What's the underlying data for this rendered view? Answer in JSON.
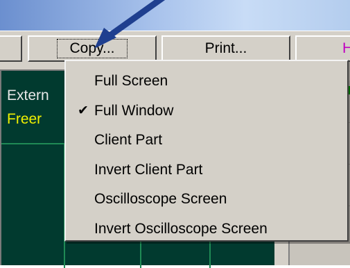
{
  "toolbar": {
    "copy_label": "Copy...",
    "print_label": "Print...",
    "right_stub_label": "H"
  },
  "scope": {
    "label_external": "Extern",
    "label_freerun": "Freer"
  },
  "menu": {
    "items": [
      {
        "label": "Full Screen",
        "checked": false
      },
      {
        "label": "Full Window",
        "checked": true
      },
      {
        "label": "Client Part",
        "checked": false
      },
      {
        "label": "Invert Client Part",
        "checked": false
      },
      {
        "label": "Oscilloscope Screen",
        "checked": false
      },
      {
        "label": "Invert Oscilloscope Screen",
        "checked": false
      }
    ],
    "check_glyph": "✔"
  },
  "colors": {
    "scope_bg": "#013a2f",
    "grid": "#1f8a55",
    "freerun_text": "#f0f000",
    "menu_bg": "#d4d0c8",
    "annotation_arrow": "#1f3f8f"
  }
}
